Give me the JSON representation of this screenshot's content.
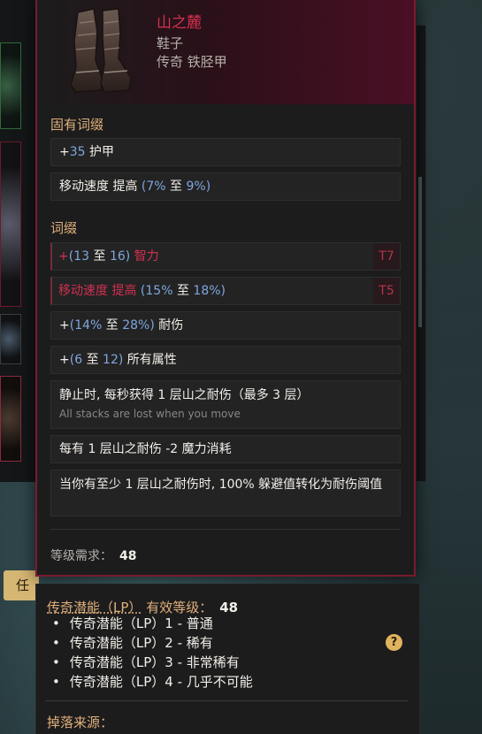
{
  "item": {
    "name": "山之麓",
    "type": "鞋子",
    "rarity_base": "传奇 铁胫甲",
    "icon": "boots-icon"
  },
  "implicit": {
    "title": "固有词缀",
    "lines": [
      {
        "prefix": "+",
        "num": "35",
        "rest": " 护甲"
      },
      {
        "text": "移动速度 提高 ",
        "range_open": "(",
        "num1": "7%",
        "to": " 至 ",
        "num2": "9%",
        "range_close": ")"
      }
    ]
  },
  "affixes": {
    "title": "词缀",
    "int_line": {
      "plus": "+",
      "open": "(",
      "num1": "13",
      "to": " 至 ",
      "num2": "16",
      "close": ")",
      "rest": " 智力",
      "tier": "T7"
    },
    "ms_line": {
      "text": "移动速度 提高 ",
      "open": "(",
      "num1": "15%",
      "to": " 至 ",
      "num2": "18%",
      "close": ")",
      "tier": "T5"
    },
    "endure_line": {
      "plus": "+",
      "open": "(",
      "num1": "14%",
      "to": " 至 ",
      "num2": "28%",
      "close": ")",
      "rest": " 耐伤"
    },
    "attr_line": {
      "plus": "+",
      "open": "(",
      "num1": "6",
      "to": " 至 ",
      "num2": "12",
      "close": ")",
      "rest": " 所有属性"
    },
    "stack_line": {
      "text": "静止时, 每秒获得 1 层山之耐伤（最多 3 层）",
      "sub": "All stacks are lost when you move"
    },
    "mana_line": "每有 1 层山之耐伤 -2 魔力消耗",
    "dodge_line": "当你有至少 1 层山之耐伤时, 100% 躲避值转化为耐伤阈值"
  },
  "requirement": {
    "label": "等级需求：",
    "value": "48"
  },
  "info": {
    "lp_label": "传奇潜能（LP）",
    "lp_suffix": "有效等级：",
    "lp_value": "48",
    "tiers": [
      "传奇潜能（LP）1 - 普通",
      "传奇潜能（LP）2 - 稀有",
      "传奇潜能（LP）3 - 非常稀有",
      "传奇潜能（LP）4 - 几乎不可能"
    ],
    "drop_title": "掉落来源：",
    "help_glyph": "?"
  },
  "partial_button": "任",
  "colors": {
    "unique_name": "#d2304f",
    "section_title": "#e0b07a",
    "value_blue": "#7fa6dd",
    "border": "#7a1a30"
  }
}
